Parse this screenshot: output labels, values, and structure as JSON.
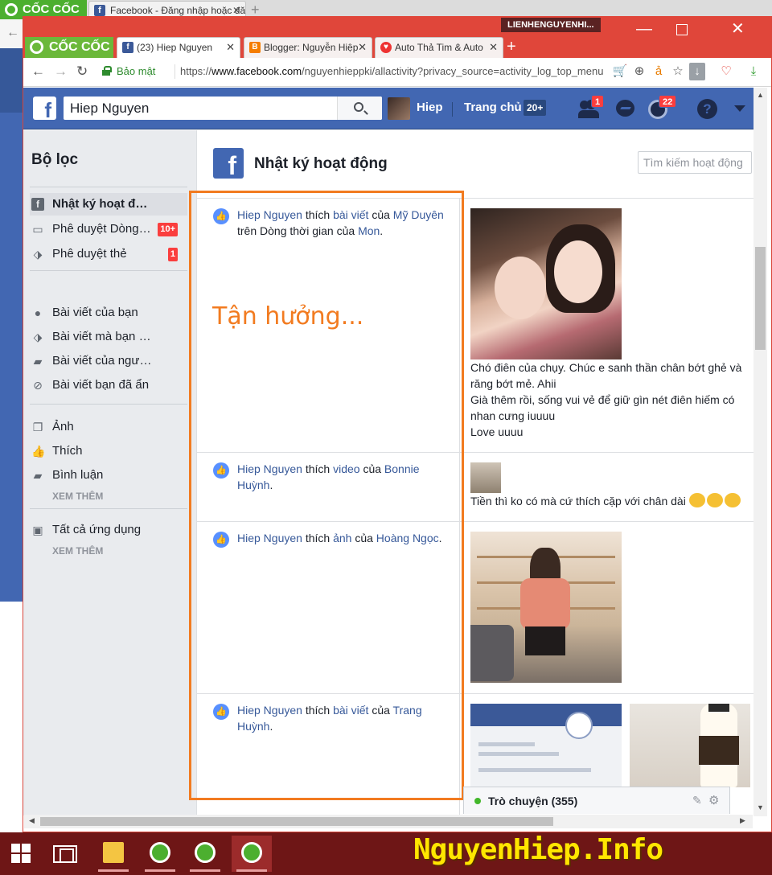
{
  "background_window": {
    "brand": "CỐC CỐC",
    "tab_title": "Facebook - Đăng nhập hoặc đăng ký"
  },
  "browser": {
    "brand": "CỐC CỐC",
    "profile": "LIENHENGUYENHI...",
    "tabs": [
      {
        "label": "(23) Hiep Nguyen",
        "icon": "facebook-icon"
      },
      {
        "label": "Blogger: Nguyễn Hiệp",
        "icon": "blogger-icon"
      },
      {
        "label": "Auto Thả Tim & Auto",
        "icon": "heart-icon"
      }
    ],
    "secure_label": "Bảo mật",
    "url_prefix": "https://",
    "url_domain": "www.facebook.com",
    "url_path": "/nguyenhieppki/allactivity?privacy_source=activity_log_top_menu"
  },
  "facebook_header": {
    "search_value": "Hiep Nguyen",
    "user_name": "Hiep",
    "home_label": "Trang chủ",
    "home_count": "20+",
    "friend_requests_badge": "1",
    "notifications_badge": "22"
  },
  "sidebar": {
    "title": "Bộ lọc",
    "items": [
      {
        "label": "Nhật ký hoạt động",
        "icon": "facebook-icon",
        "count": "",
        "active": true
      },
      {
        "label": "Phê duyệt Dòng thời gian",
        "icon": "timeline-icon",
        "count": "10+"
      },
      {
        "label": "Phê duyệt thẻ",
        "icon": "tag-review-icon",
        "count": "1"
      },
      {
        "label": "Bài viết của bạn",
        "icon": "person-icon",
        "count": ""
      },
      {
        "label": "Bài viết mà bạn được gắn thẻ",
        "icon": "tag-icon",
        "count": ""
      },
      {
        "label": "Bài viết của người khác",
        "icon": "comment-icon",
        "count": ""
      },
      {
        "label": "Bài viết bạn đã ẩn",
        "icon": "hidden-icon",
        "count": ""
      },
      {
        "label": "Ảnh",
        "icon": "photos-icon",
        "count": ""
      },
      {
        "label": "Thích",
        "icon": "like-icon",
        "count": ""
      },
      {
        "label": "Bình luận",
        "icon": "comment-icon",
        "count": ""
      },
      {
        "label": "Tất cả ứng dụng",
        "icon": "apps-icon",
        "count": ""
      }
    ],
    "see_more": "XEM THÊM"
  },
  "activity": {
    "title": "Nhật ký hoạt động",
    "search_placeholder": "Tìm kiếm hoạt động",
    "entries": [
      {
        "actor": "Hiep Nguyen",
        "verb": "thích",
        "object": "bài viết",
        "of": "của",
        "owner": "Mỹ Duyên",
        "extra_pre": "trên Dòng thời gian của",
        "extra_name": "Mon",
        "caption": [
          "Chó điên của chụy. Chúc e sanh thần chân bớt ghẻ và răng bớt mẻ. Ahii",
          "Già thêm rồi, sống vui vẻ để giữ gìn nét điên hiếm có nhan cưng iuuuu",
          "Love uuuu"
        ]
      },
      {
        "actor": "Hiep Nguyen",
        "verb": "thích",
        "object": "video",
        "of": "của",
        "owner": "Bonnie Huỳnh",
        "caption": [
          "Tiền thì ko có mà cứ thích cặp với chân dài"
        ]
      },
      {
        "actor": "Hiep Nguyen",
        "verb": "thích",
        "object": "ảnh",
        "of": "của",
        "owner": "Hoàng Ngọc"
      },
      {
        "actor": "Hiep Nguyen",
        "verb": "thích",
        "object": "bài viết",
        "of": "của",
        "owner": "Trang Huỳnh"
      }
    ]
  },
  "annotation_text": "Tận hưởng...",
  "chat": {
    "label": "Trò chuyện (355)"
  },
  "watermark": "NguyenHiep.Info",
  "colors": {
    "facebook_blue": "#4267b2",
    "link": "#365899",
    "browser_red": "#e0463a",
    "annotation_orange": "#f27b20",
    "badge_red": "#fa3e3e",
    "watermark_yellow": "#ffe600"
  }
}
